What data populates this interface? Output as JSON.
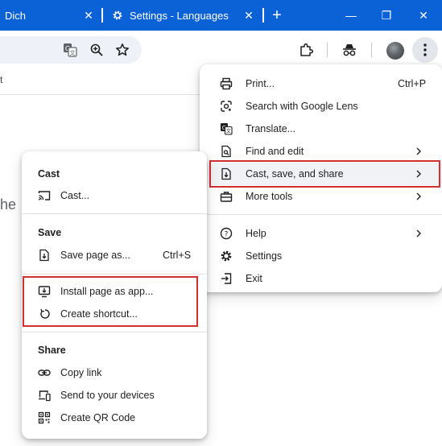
{
  "tabs": [
    {
      "title": "Dich",
      "close": "✕"
    },
    {
      "title": "Settings - Languages",
      "close": "✕"
    }
  ],
  "window": {
    "new_tab": "+",
    "minimize": "—",
    "restore": "❐",
    "close": "✕"
  },
  "bookmark_bar": {
    "fragment": "t"
  },
  "page": {
    "fragment": "he"
  },
  "colors": {
    "titlebar": "#0b62d6",
    "highlight_border": "#d32f2f",
    "menu_hover": "#f0f2f6"
  },
  "main_menu": {
    "items": [
      {
        "label": "Print...",
        "shortcut": "Ctrl+P",
        "icon": "print-icon"
      },
      {
        "label": "Search with Google Lens",
        "icon": "google-lens-icon"
      },
      {
        "label": "Translate...",
        "icon": "translate-icon"
      },
      {
        "label": "Find and edit",
        "icon": "find-icon",
        "submenu": true
      },
      {
        "label": "Cast, save, and share",
        "icon": "cast-save-share-icon",
        "submenu": true,
        "highlighted": true
      },
      {
        "label": "More tools",
        "icon": "toolbox-icon",
        "submenu": true
      },
      {
        "label": "Help",
        "icon": "help-icon",
        "submenu": true
      },
      {
        "label": "Settings",
        "icon": "settings-icon"
      },
      {
        "label": "Exit",
        "icon": "exit-icon"
      }
    ]
  },
  "sub_menu": {
    "cast": {
      "heading": "Cast",
      "items": [
        {
          "label": "Cast...",
          "icon": "cast-icon"
        }
      ]
    },
    "save": {
      "heading": "Save",
      "items": [
        {
          "label": "Save page as...",
          "shortcut": "Ctrl+S",
          "icon": "save-page-icon"
        },
        {
          "label": "Install page as app...",
          "icon": "install-app-icon"
        },
        {
          "label": "Create shortcut...",
          "icon": "create-shortcut-icon"
        }
      ]
    },
    "share": {
      "heading": "Share",
      "items": [
        {
          "label": "Copy link",
          "icon": "link-icon"
        },
        {
          "label": "Send to your devices",
          "icon": "devices-icon"
        },
        {
          "label": "Create QR Code",
          "icon": "qr-code-icon"
        }
      ]
    }
  }
}
